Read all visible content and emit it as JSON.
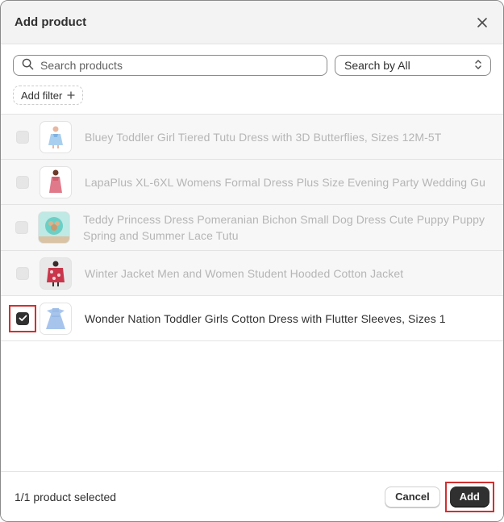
{
  "modal": {
    "title": "Add product",
    "close_icon": "close-icon"
  },
  "search": {
    "placeholder": "Search products",
    "value": "",
    "icon": "search-icon"
  },
  "search_by": {
    "label": "Search by All",
    "icon": "chevron-up-down-icon"
  },
  "filter": {
    "label": "Add filter",
    "icon": "plus-icon"
  },
  "products": [
    {
      "title": "Bluey Toddler Girl Tiered Tutu Dress with 3D Butterflies, Sizes 12M-5T",
      "checked": false,
      "disabled": true
    },
    {
      "title": "LapaPlus XL-6XL Womens Formal Dress Plus Size Evening Party Wedding Gu",
      "checked": false,
      "disabled": true
    },
    {
      "title": "Teddy Princess Dress Pomeranian Bichon Small Dog Dress Cute Puppy Puppy Spring and Summer Lace Tutu",
      "checked": false,
      "disabled": true
    },
    {
      "title": "Winter Jacket Men and Women Student Hooded Cotton Jacket",
      "checked": false,
      "disabled": true
    },
    {
      "title": "Wonder Nation Toddler Girls Cotton Dress with Flutter Sleeves, Sizes 1",
      "checked": true,
      "disabled": false
    }
  ],
  "footer": {
    "status": "1/1 product selected",
    "cancel_label": "Cancel",
    "add_label": "Add"
  },
  "colors": {
    "primary_button": "#303030",
    "highlight": "#d32f2f",
    "disabled_text": "#b5b5b5"
  }
}
